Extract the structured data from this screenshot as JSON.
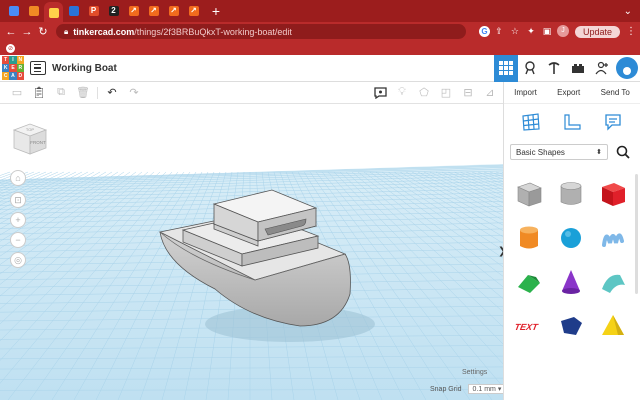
{
  "browser": {
    "tabs": [
      {
        "icon": "docs-icon",
        "color": "#4a8cf7",
        "glyph": ""
      },
      {
        "icon": "orange-leaf-icon",
        "color": "#f08a24",
        "glyph": ""
      },
      {
        "icon": "tinkercad-grid-icon",
        "color": "#ffd24a",
        "glyph": "",
        "active": true
      },
      {
        "icon": "blue-square-icon",
        "color": "#2a73d8",
        "glyph": ""
      },
      {
        "icon": "p-icon",
        "color": "#e14d2a",
        "glyph": "P"
      },
      {
        "icon": "two-icon",
        "color": "#222222",
        "glyph": "2"
      },
      {
        "icon": "arrow-orange-icon",
        "color": "#f26b1d",
        "glyph": "↗"
      },
      {
        "icon": "arrow-orange-icon",
        "color": "#f26b1d",
        "glyph": "↗"
      },
      {
        "icon": "arrow-orange-icon",
        "color": "#f26b1d",
        "glyph": "↗"
      },
      {
        "icon": "arrow-orange-icon",
        "color": "#f26b1d",
        "glyph": "↗"
      }
    ],
    "url_host": "tinkercad.com",
    "url_path": "/things/2f3BRBuQkxT-working-boat/edit",
    "update_label": "Update",
    "profile_initial": "J"
  },
  "app": {
    "title": "Working Boat",
    "logo_letters": [
      "T",
      "I",
      "N",
      "K",
      "E",
      "R",
      "C",
      "A",
      "D"
    ],
    "logo_colors": [
      "#e64c3c",
      "#2a9d8f",
      "#f4a623",
      "#3b82c4",
      "#e64c3c",
      "#66b032",
      "#f4a623",
      "#3b82c4",
      "#e64c3c"
    ]
  },
  "panel": {
    "import_label": "Import",
    "export_label": "Export",
    "sendto_label": "Send To",
    "library_label": "Basic Shapes",
    "shapes": [
      {
        "name": "box-striped",
        "color": "#b8b8b8"
      },
      {
        "name": "cylinder-striped",
        "color": "#b8b8b8"
      },
      {
        "name": "box",
        "color": "#e0202a"
      },
      {
        "name": "cylinder",
        "color": "#f08a24"
      },
      {
        "name": "sphere",
        "color": "#1aa0d8"
      },
      {
        "name": "scribble",
        "color": "#7fb8e8"
      },
      {
        "name": "roof",
        "color": "#2bb24c"
      },
      {
        "name": "cone",
        "color": "#8a35c9"
      },
      {
        "name": "round-roof",
        "color": "#5dc6c4"
      },
      {
        "name": "text",
        "color": "#e0202a"
      },
      {
        "name": "half-sphere",
        "color": "#1f3c8a"
      },
      {
        "name": "pyramid",
        "color": "#f5d216"
      }
    ]
  },
  "workplane": {
    "settings_label": "Settings",
    "snap_label": "Snap Grid",
    "snap_value": "0.1 mm ▾",
    "viewcube_top": "TOP",
    "viewcube_front": "FRONT"
  }
}
